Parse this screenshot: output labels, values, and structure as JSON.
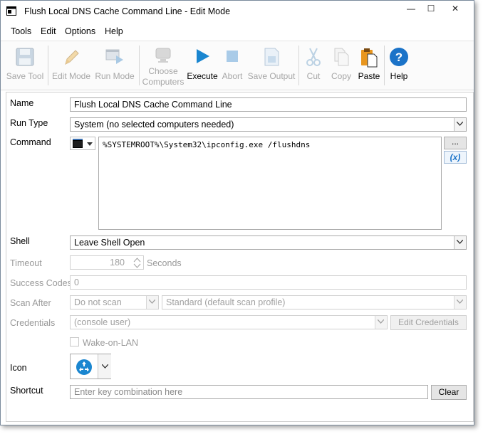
{
  "window": {
    "title": "Flush Local DNS Cache Command Line - Edit Mode",
    "minimize": "—",
    "maximize": "☐",
    "close": "✕"
  },
  "menu": [
    "Tools",
    "Edit",
    "Options",
    "Help"
  ],
  "toolbar": {
    "save_tool": "Save Tool",
    "edit_mode": "Edit Mode",
    "run_mode": "Run Mode",
    "choose_computers": "Choose Computers",
    "execute": "Execute",
    "abort": "Abort",
    "save_output": "Save Output",
    "cut": "Cut",
    "copy": "Copy",
    "paste": "Paste",
    "help": "Help"
  },
  "form": {
    "name_label": "Name",
    "name_value": "Flush Local DNS Cache Command Line",
    "run_type_label": "Run Type",
    "run_type_value": "System (no selected computers needed)",
    "command_label": "Command",
    "command_value": "%SYSTEMROOT%\\System32\\ipconfig.exe /flushdns",
    "browse_button": "...",
    "variable_button": "(x)",
    "shell_label": "Shell",
    "shell_value": "Leave Shell Open",
    "timeout_label": "Timeout",
    "timeout_value": "180",
    "timeout_unit": "Seconds",
    "success_codes_label": "Success Codes",
    "success_codes_value": "0",
    "scan_after_label": "Scan After",
    "scan_after_value": "Do not scan",
    "scan_profile_value": "Standard (default scan profile)",
    "credentials_label": "Credentials",
    "credentials_value": "(console user)",
    "edit_credentials_button": "Edit Credentials",
    "wake_on_lan_label": "Wake-on-LAN",
    "wake_on_lan_checked": false,
    "icon_label": "Icon",
    "shortcut_label": "Shortcut",
    "shortcut_placeholder": "Enter key combination here",
    "clear_button": "Clear"
  },
  "colors": {
    "accent": "#1a86d0",
    "help_blue": "#1b73c8",
    "disabled": "#a6a6a6",
    "paste_orange": "#e8961e"
  }
}
